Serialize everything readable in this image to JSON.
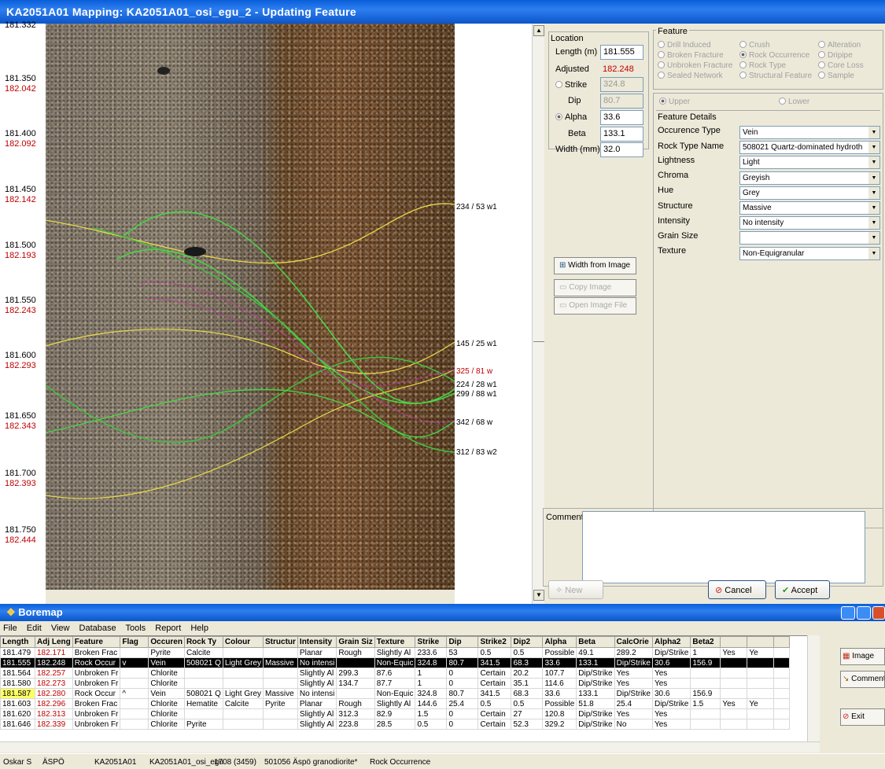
{
  "window": {
    "title": "KA2051A01 Mapping: KA2051A01_osi_egu_2 - Updating Feature"
  },
  "depth_scale": {
    "top_partial": "181.332",
    "ticks": [
      {
        "length": "181.350",
        "adjusted": "182.042"
      },
      {
        "length": "181.400",
        "adjusted": "182.092"
      },
      {
        "length": "181.450",
        "adjusted": "182.142"
      },
      {
        "length": "181.500",
        "adjusted": "182.193"
      },
      {
        "length": "181.550",
        "adjusted": "182.243"
      },
      {
        "length": "181.600",
        "adjusted": "182.293"
      },
      {
        "length": "181.650",
        "adjusted": "182.343"
      },
      {
        "length": "181.700",
        "adjusted": "182.393"
      },
      {
        "length": "181.750",
        "adjusted": "182.444"
      }
    ]
  },
  "trace_labels": [
    {
      "text": "234 / 53 w1",
      "color": "#000000"
    },
    {
      "text": "145 / 25 w1",
      "color": "#000000"
    },
    {
      "text": "325 / 81 w",
      "color": "#c00000"
    },
    {
      "text": "224 / 28 w1",
      "color": "#000000"
    },
    {
      "text": "299 / 88 w1",
      "color": "#000000"
    },
    {
      "text": "342 / 68 w",
      "color": "#000000"
    },
    {
      "text": "312 / 83 w2",
      "color": "#000000"
    }
  ],
  "location": {
    "title": "Location",
    "length_label": "Length (m)",
    "length_value": "181.555",
    "adjusted_label": "Adjusted",
    "adjusted_value": "182.248",
    "strike_label": "Strike",
    "strike_value": "324.8",
    "dip_label": "Dip",
    "dip_value": "80.7",
    "alpha_label": "Alpha",
    "alpha_value": "33.6",
    "beta_label": "Beta",
    "beta_value": "133.1",
    "width_label": "Width (mm)",
    "width_value": "32.0"
  },
  "feature": {
    "title": "Feature",
    "options": [
      "Drill Induced",
      "Crush",
      "Alteration",
      "Broken Fracture",
      "Rock Occurrence",
      "Dripipe",
      "Unbroken Fracture",
      "Rock Type",
      "Core Loss",
      "Sealed Network",
      "Structural Feature",
      "Sample"
    ],
    "selected": "Rock Occurrence"
  },
  "position": {
    "upper": "Upper",
    "lower": "Lower"
  },
  "details": {
    "title": "Feature Details",
    "rows": [
      {
        "label": "Occurence Type",
        "value": "Vein"
      },
      {
        "label": "Rock Type Name",
        "value": "508021 Quartz-dominated hydroth"
      },
      {
        "label": "Lightness",
        "value": "Light"
      },
      {
        "label": "Chroma",
        "value": "Greyish"
      },
      {
        "label": "Hue",
        "value": "Grey"
      },
      {
        "label": "Structure",
        "value": "Massive"
      },
      {
        "label": "Intensity",
        "value": "No intensity"
      },
      {
        "label": "Grain Size",
        "value": ""
      },
      {
        "label": "Texture",
        "value": "Non-Equigranular"
      }
    ]
  },
  "image_buttons": {
    "width_from_image": "Width from Image",
    "copy_image": "Copy Image",
    "open_image_file": "Open Image File"
  },
  "comment": {
    "label": "Comment",
    "value": ""
  },
  "actions": {
    "new": "New",
    "cancel": "Cancel",
    "accept": "Accept"
  },
  "boremap": {
    "title": "Boremap",
    "menu": [
      "File",
      "Edit",
      "View",
      "Database",
      "Tools",
      "Report",
      "Help"
    ],
    "columns": [
      "Length",
      "Adj Leng",
      "Feature",
      "Flag",
      "Occuren",
      "Rock Ty",
      "Colour",
      "Structur",
      "Intensity",
      "Grain Siz",
      "Texture",
      "Strike",
      "Dip",
      "Strike2",
      "Dip2",
      "Alpha",
      "Beta",
      "CalcOrie",
      "Alpha2",
      "Beta2",
      "",
      "",
      ""
    ],
    "rows": [
      [
        "181.479",
        "182.171",
        "Broken Frac",
        "",
        "Pyrite",
        "Calcite",
        "",
        "",
        "Planar",
        "Rough",
        "Slightly Al",
        "233.6",
        "53",
        "0.5",
        "0.5",
        "Possible",
        "49.1",
        "289.2",
        "Dip/Strike",
        "1",
        "Yes",
        "Ye",
        ""
      ],
      [
        "181.555",
        "182.248",
        "Rock Occur",
        "v",
        "Vein",
        "508021 Q",
        "Light Grey",
        "Massive",
        "No intensi",
        "",
        "Non-Equic",
        "324.8",
        "80.7",
        "341.5",
        "68.3",
        "33.6",
        "133.1",
        "Dip/Strike",
        "30.6",
        "156.9",
        "",
        "",
        ""
      ],
      [
        "181.564",
        "182.257",
        "Unbroken Fr",
        "",
        "Chlorite",
        "",
        "",
        "",
        "Slightly Al",
        "299.3",
        "87.6",
        "1",
        "0",
        "Certain",
        "20.2",
        "107.7",
        "Dip/Strike",
        "Yes",
        "Yes",
        "",
        "",
        "",
        ""
      ],
      [
        "181.580",
        "182.273",
        "Unbroken Fr",
        "",
        "Chlorite",
        "",
        "",
        "",
        "Slightly Al",
        "134.7",
        "87.7",
        "1",
        "0",
        "Certain",
        "35.1",
        "114.6",
        "Dip/Strike",
        "Yes",
        "Yes",
        "",
        "",
        "",
        ""
      ],
      [
        "181.587",
        "182.280",
        "Rock Occur",
        "^",
        "Vein",
        "508021 Q",
        "Light Grey",
        "Massive",
        "No intensi",
        "",
        "Non-Equic",
        "324.8",
        "80.7",
        "341.5",
        "68.3",
        "33.6",
        "133.1",
        "Dip/Strike",
        "30.6",
        "156.9",
        "",
        "",
        ""
      ],
      [
        "181.603",
        "182.296",
        "Broken Frac",
        "",
        "Chlorite",
        "Hematite",
        "Calcite",
        "Pyrite",
        "Planar",
        "Rough",
        "Slightly Al",
        "144.6",
        "25.4",
        "0.5",
        "0.5",
        "Possible",
        "51.8",
        "25.4",
        "Dip/Strike",
        "1.5",
        "Yes",
        "Ye",
        ""
      ],
      [
        "181.620",
        "182.313",
        "Unbroken Fr",
        "",
        "Chlorite",
        "",
        "",
        "",
        "Slightly Al",
        "312.3",
        "82.9",
        "1.5",
        "0",
        "Certain",
        "27",
        "120.8",
        "Dip/Strike",
        "Yes",
        "Yes",
        "",
        "",
        "",
        ""
      ],
      [
        "181.646",
        "182.339",
        "Unbroken Fr",
        "",
        "Chlorite",
        "Pyrite",
        "",
        "",
        "Slightly Al",
        "223.8",
        "28.5",
        "0.5",
        "0",
        "Certain",
        "52.3",
        "329.2",
        "Dip/Strike",
        "No",
        "Yes",
        "",
        "",
        "",
        ""
      ]
    ],
    "side_buttons": {
      "image": "Image",
      "comment": "Comment",
      "exit": "Exit"
    }
  },
  "status_bar": [
    "Oskar S",
    "ÄSPÖ",
    "KA2051A01",
    "KA2051A01_osi_egu",
    "1708 (3459)",
    "501056 Äspö granodiorite*",
    "Rock Occurrence"
  ]
}
